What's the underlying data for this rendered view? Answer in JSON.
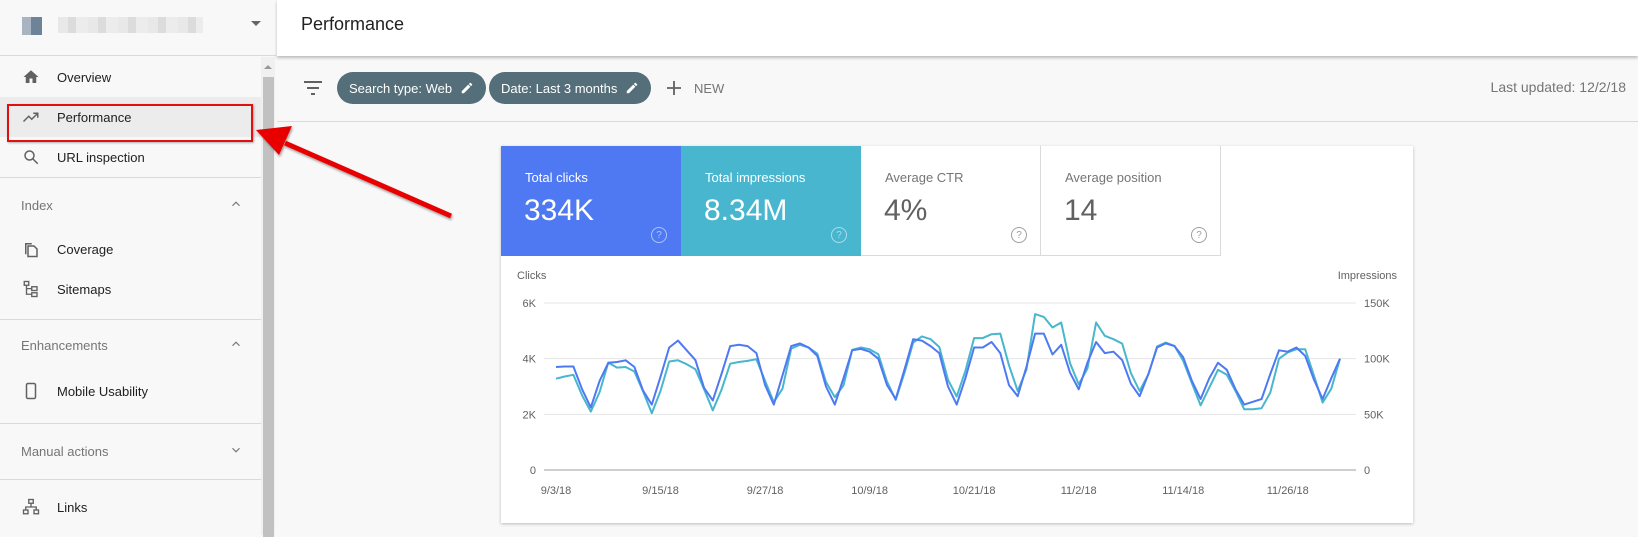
{
  "property": {
    "name_redacted": true
  },
  "sidebar": {
    "top_items": [
      {
        "label": "Overview",
        "icon": "home-icon"
      },
      {
        "label": "Performance",
        "icon": "trending-up-icon",
        "active": true
      },
      {
        "label": "URL inspection",
        "icon": "search-icon"
      }
    ],
    "sections": [
      {
        "label": "Index",
        "expanded": true,
        "items": [
          {
            "label": "Coverage",
            "icon": "coverage-icon"
          },
          {
            "label": "Sitemaps",
            "icon": "sitemap-icon"
          }
        ]
      },
      {
        "label": "Enhancements",
        "expanded": true,
        "items": [
          {
            "label": "Mobile Usability",
            "icon": "phone-icon"
          }
        ]
      },
      {
        "label": "Manual actions",
        "expanded": false,
        "items": []
      }
    ],
    "bottom_items": [
      {
        "label": "Links",
        "icon": "links-icon"
      }
    ]
  },
  "header": {
    "title": "Performance"
  },
  "toolbar": {
    "chips": [
      {
        "label": "Search type: Web"
      },
      {
        "label": "Date: Last 3 months"
      }
    ],
    "new_label": "NEW",
    "last_updated": "Last updated: 12/2/18"
  },
  "metrics": [
    {
      "label": "Total clicks",
      "value": "334K",
      "selected": true,
      "color": "#4f79f2"
    },
    {
      "label": "Total impressions",
      "value": "8.34M",
      "selected": true,
      "color": "#48b6ce"
    },
    {
      "label": "Average CTR",
      "value": "4%",
      "selected": false
    },
    {
      "label": "Average position",
      "value": "14",
      "selected": false
    }
  ],
  "chart_data": {
    "type": "line",
    "title": "",
    "ylabel_left": "Clicks",
    "ylabel_right": "Impressions",
    "left_ticks": [
      "0",
      "2K",
      "4K",
      "6K"
    ],
    "right_ticks": [
      "0",
      "50K",
      "100K",
      "150K"
    ],
    "ylim_left": [
      0,
      6000
    ],
    "ylim_right": [
      0,
      150000
    ],
    "x_ticks": [
      "9/3/18",
      "9/15/18",
      "9/27/18",
      "10/9/18",
      "10/21/18",
      "11/2/18",
      "11/14/18",
      "11/26/18"
    ],
    "x_start": "9/3/18",
    "x_end": "12/1/18",
    "grid": true,
    "series": [
      {
        "name": "Clicks",
        "axis": "left",
        "color": "#4f79f2",
        "values": [
          3700,
          3720,
          3720,
          2900,
          2250,
          3200,
          3850,
          3880,
          3940,
          3700,
          2850,
          2350,
          3350,
          4400,
          4650,
          4300,
          3950,
          2950,
          2500,
          3450,
          4450,
          4500,
          4450,
          4200,
          3050,
          2350,
          3400,
          4450,
          4550,
          4400,
          4100,
          3000,
          2350,
          3300,
          4300,
          4350,
          4250,
          4000,
          3050,
          2550,
          3600,
          4700,
          4650,
          4450,
          4200,
          3000,
          2350,
          3300,
          4400,
          4400,
          4600,
          4200,
          3050,
          2650,
          3700,
          4900,
          4900,
          4150,
          4500,
          3500,
          2900,
          3850,
          4600,
          4200,
          4250,
          3950,
          3100,
          2650,
          3450,
          4400,
          4550,
          4450,
          4050,
          3200,
          2550,
          3300,
          3850,
          3600,
          2900,
          2350,
          2450,
          2550,
          3450,
          4300,
          4250,
          4400,
          4100,
          3250,
          2550,
          3300,
          4000
        ]
      },
      {
        "name": "Impressions",
        "axis": "right",
        "color": "#48b6ce",
        "values": [
          82000,
          84000,
          85500,
          67000,
          52500,
          70000,
          96500,
          92000,
          92500,
          88500,
          70500,
          51000,
          71000,
          97500,
          98500,
          95000,
          90500,
          72500,
          53500,
          72000,
          95500,
          97000,
          98000,
          99500,
          80000,
          61000,
          73000,
          109000,
          112500,
          110000,
          104500,
          79000,
          65500,
          76000,
          108000,
          110000,
          108500,
          104000,
          79500,
          63000,
          87000,
          114500,
          120000,
          117500,
          110500,
          81000,
          66000,
          89000,
          118500,
          118500,
          122000,
          122500,
          94000,
          71000,
          90000,
          140000,
          137500,
          128000,
          132500,
          96000,
          77000,
          91000,
          132500,
          120500,
          117500,
          113500,
          87000,
          71000,
          86000,
          111000,
          114500,
          111500,
          98000,
          78000,
          58000,
          74000,
          90000,
          85500,
          71000,
          54500,
          54500,
          55500,
          69500,
          100000,
          105500,
          108500,
          108500,
          85000,
          60500,
          73000,
          100000
        ]
      }
    ]
  }
}
